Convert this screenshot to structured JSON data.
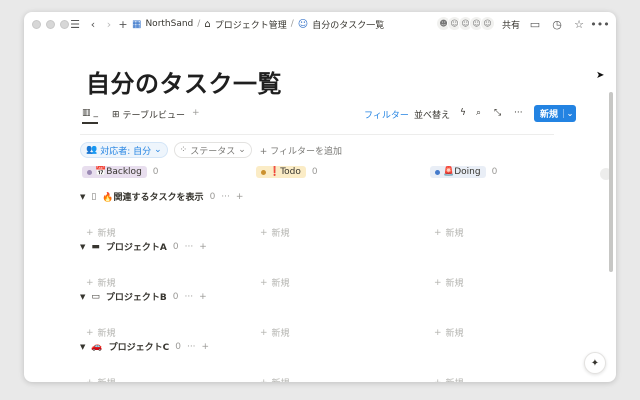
{
  "topbar": {
    "breadcrumbs": [
      {
        "icon": "building-icon",
        "label": "NorthSand"
      },
      {
        "icon": "org-chart-icon",
        "label": "プロジェクト管理"
      },
      {
        "icon": "person-check-icon",
        "label": "自分のタスク一覧"
      }
    ],
    "share_label": "共有"
  },
  "page": {
    "title": "自分のタスク一覧"
  },
  "views": {
    "tabs": [
      {
        "icon": "board-icon",
        "label": "_"
      },
      {
        "icon": "table-icon",
        "label": "テーブルビュー"
      }
    ],
    "filter_label": "フィルター",
    "sort_label": "並べ替え",
    "new_label": "新規"
  },
  "filters": {
    "assignee_chip": "対応者: 自分",
    "status_chip": "ステータス",
    "add_filter": "+ フィルターを追加"
  },
  "board": {
    "columns": [
      {
        "label": "📅Backlog",
        "count": "0",
        "color": "#9b8ab4",
        "bg": "#e8deee"
      },
      {
        "label": "❗Todo",
        "count": "0",
        "color": "#cb912f",
        "bg": "#fbecc6"
      },
      {
        "label": "🚨Doing",
        "count": "0",
        "color": "#447acb",
        "bg": "#e9eef6"
      }
    ],
    "groups": [
      {
        "label": "🔥関連するタスクを表示",
        "count": "0",
        "icon": "page-icon"
      },
      {
        "label": "プロジェクトA",
        "count": "0",
        "icon": "book-icon"
      },
      {
        "label": "プロジェクトB",
        "count": "0",
        "icon": "laptop-icon"
      },
      {
        "label": "プロジェクトC",
        "count": "0",
        "icon": "car-icon"
      }
    ],
    "new_label": "新規"
  }
}
